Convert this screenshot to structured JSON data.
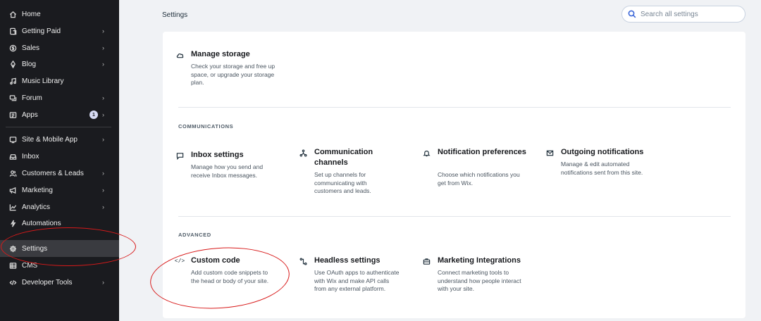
{
  "sidebar": {
    "items": [
      {
        "label": "Home",
        "icon": "home-icon",
        "chevron": false
      },
      {
        "label": "Getting Paid",
        "icon": "payment-icon",
        "chevron": true
      },
      {
        "label": "Sales",
        "icon": "dollar-icon",
        "chevron": true
      },
      {
        "label": "Blog",
        "icon": "pen-icon",
        "chevron": true
      },
      {
        "label": "Music Library",
        "icon": "music-icon",
        "chevron": false
      },
      {
        "label": "Forum",
        "icon": "forum-icon",
        "chevron": true
      },
      {
        "label": "Apps",
        "icon": "apps-icon",
        "chevron": true,
        "badge": "1"
      },
      {
        "label": "Site & Mobile App",
        "icon": "site-icon",
        "chevron": true
      },
      {
        "label": "Inbox",
        "icon": "inbox-icon",
        "chevron": false
      },
      {
        "label": "Customers & Leads",
        "icon": "customers-icon",
        "chevron": true
      },
      {
        "label": "Marketing",
        "icon": "megaphone-icon",
        "chevron": true
      },
      {
        "label": "Analytics",
        "icon": "analytics-icon",
        "chevron": true
      },
      {
        "label": "Automations",
        "icon": "lightning-icon",
        "chevron": false
      },
      {
        "label": "Settings",
        "icon": "gear-icon",
        "chevron": false,
        "active": true
      },
      {
        "label": "CMS",
        "icon": "database-icon",
        "chevron": false
      },
      {
        "label": "Developer Tools",
        "icon": "code-icon",
        "chevron": true
      }
    ],
    "chevron_glyph": "›"
  },
  "header": {
    "title": "Settings",
    "search_placeholder": "Search all settings"
  },
  "storage": {
    "title": "Manage storage",
    "description": "Check your storage and free up space, or upgrade your storage plan."
  },
  "communications": {
    "section_title": "COMMUNICATIONS",
    "tiles": [
      {
        "title": "Inbox settings",
        "description": "Manage how you send and receive Inbox messages."
      },
      {
        "title": "Communication channels",
        "description": "Set up channels for communicating with customers and leads."
      },
      {
        "title": "Notification preferences",
        "description": "Choose which notifications you get from Wix."
      },
      {
        "title": "Outgoing notifications",
        "description": "Manage & edit automated notifications sent from this site."
      }
    ]
  },
  "advanced": {
    "section_title": "ADVANCED",
    "tiles": [
      {
        "title": "Custom code",
        "icon_glyph": "</>",
        "description": "Add custom code snippets to the head or body of your site."
      },
      {
        "title": "Headless settings",
        "description": "Use OAuth apps to authenticate with Wix and make API calls from any external platform."
      },
      {
        "title": "Marketing Integrations",
        "description": "Connect marketing tools to understand how people interact with your site."
      }
    ]
  },
  "colors": {
    "sidebar_bg": "#1a1b1f",
    "active_item_bg": "#3a3b40",
    "page_bg": "#f0f2f5",
    "card_bg": "#ffffff",
    "search_icon": "#3b66d8",
    "annotation_red": "#d81a1a"
  }
}
